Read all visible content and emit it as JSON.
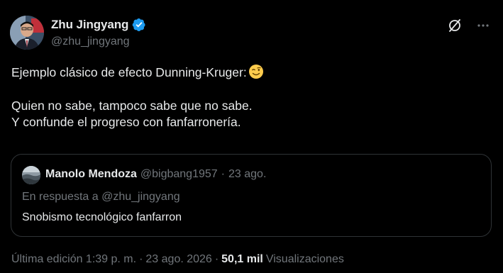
{
  "author": {
    "display_name": "Zhu Jingyang",
    "handle": "@zhu_jingyang",
    "verified_icon": "verified-badge-icon",
    "accent": "#1d9bf0"
  },
  "actions": {
    "grok_icon": "grok-icon",
    "more_icon": "more-icon"
  },
  "tweet": {
    "line1": "Ejemplo clásico de efecto Dunning-Kruger:",
    "emoji": "winking-face-emoji",
    "line2": "Quien no sabe, tampoco sabe que no sabe.",
    "line3": "Y confunde el progreso con fanfarronería."
  },
  "quote": {
    "name": "Manolo Mendoza",
    "handle": "@bigbang1957",
    "separator": "·",
    "date": "23 ago.",
    "reply_prefix": "En respuesta a",
    "reply_handle": "@zhu_jingyang",
    "text": "Snobismo tecnológico fanfarron"
  },
  "meta": {
    "edited": "Última edición 1:39 p. m.",
    "sep1": "·",
    "date": "23 ago. 2026",
    "sep2": "·",
    "views_count": "50,1 mil",
    "views_label": "Visualizaciones"
  },
  "colors": {
    "background": "#000000",
    "text_primary": "#e7e9ea",
    "text_secondary": "#71767b",
    "border": "#2f3336"
  }
}
